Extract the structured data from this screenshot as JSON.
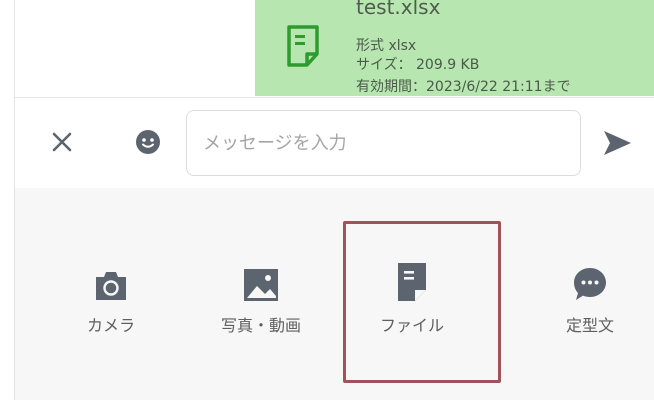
{
  "message": {
    "file_name": "test.xlsx",
    "format_line": "形式 xlsx",
    "size_line": "サイズ： 209.9 KB",
    "expiry_line": "有効期間：2023/6/22 21:11まで"
  },
  "composer": {
    "placeholder": "メッセージを入力",
    "value": ""
  },
  "attach_menu": {
    "items": [
      {
        "label": "カメラ",
        "icon": "camera-icon"
      },
      {
        "label": "写真・動画",
        "icon": "image-icon"
      },
      {
        "label": "ファイル",
        "icon": "file-icon"
      },
      {
        "label": "定型文",
        "icon": "chat-bubble-icon"
      }
    ],
    "highlighted": "ファイル"
  },
  "colors": {
    "bubble": "#b7e6b1",
    "icon_gray": "#5c6470",
    "highlight_border": "#a2525a",
    "file_icon_green": "#2e9b2e"
  }
}
